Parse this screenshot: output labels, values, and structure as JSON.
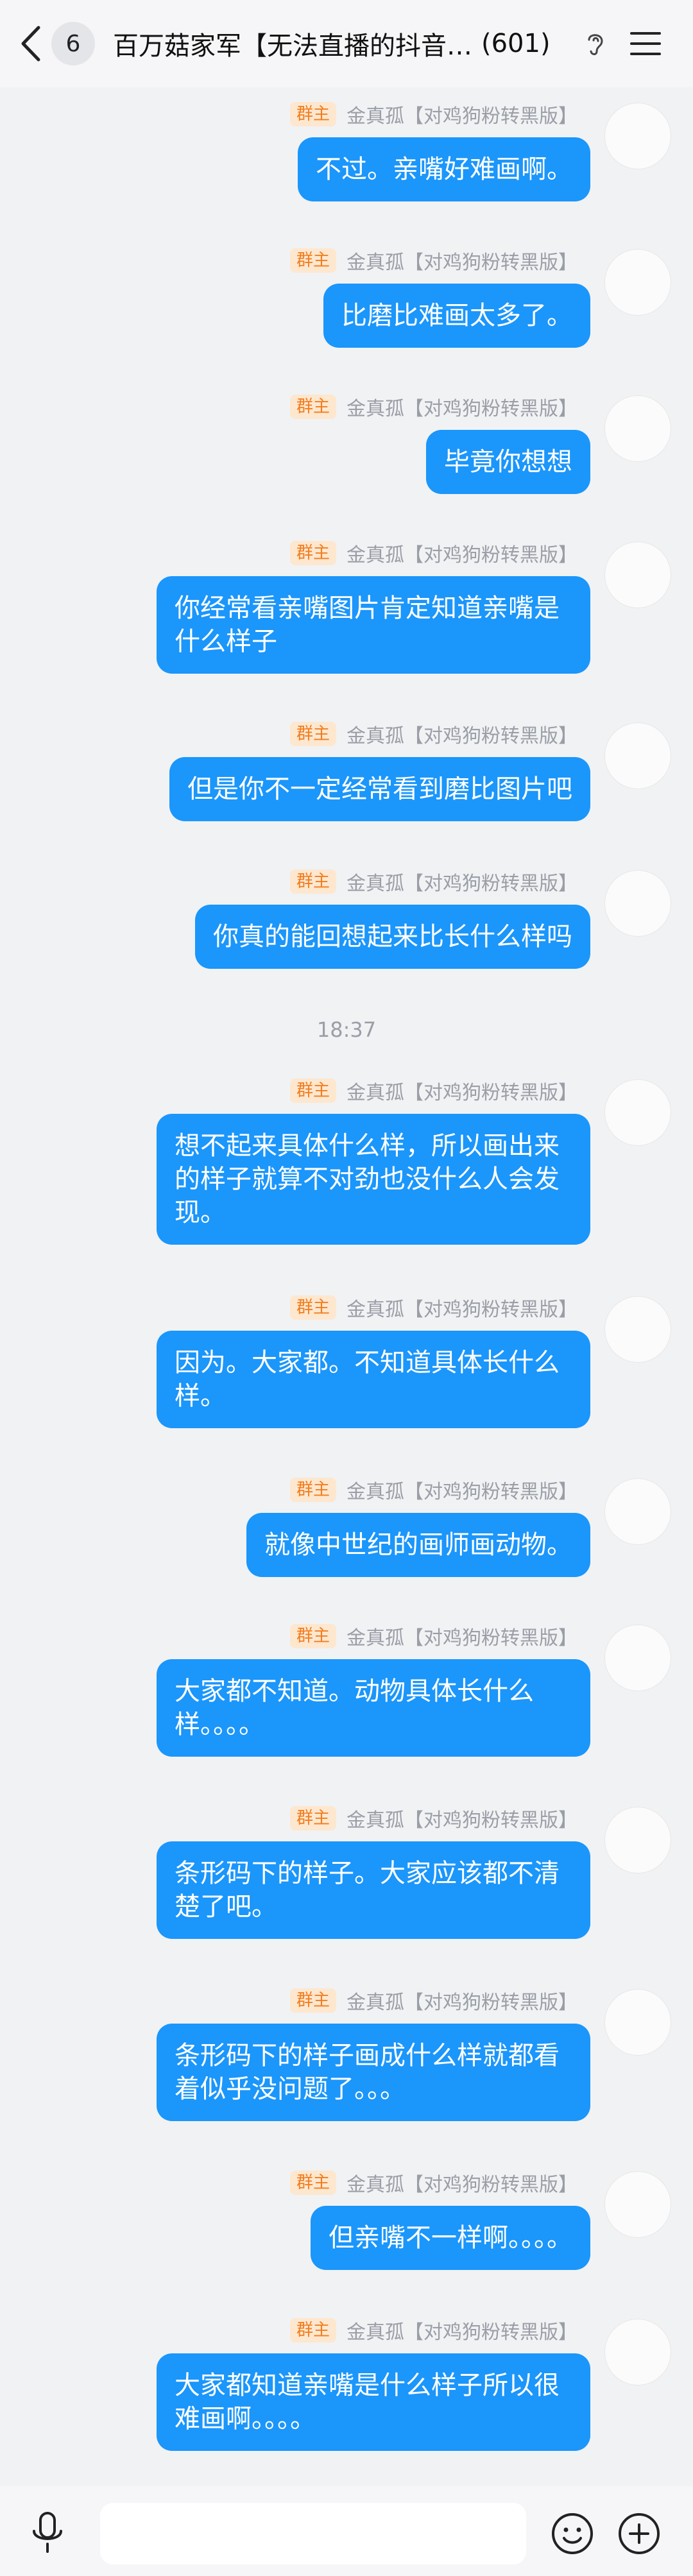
{
  "header": {
    "unread_count": "6",
    "group_name": "百万菇家军【无法直播的抖音…",
    "member_count": "(601)",
    "back_icon": "chevron-left-icon",
    "ear_icon": "ear-icon",
    "menu_icon": "hamburger-menu-icon"
  },
  "sender": {
    "role": "群主",
    "nickname": "金真孤【对鸡狗粉转黑版】"
  },
  "messages": [
    {
      "text": "不过。亲嘴好难画啊。"
    },
    {
      "text": "比磨比难画太多了。"
    },
    {
      "text": "毕竟你想想"
    },
    {
      "text": "你经常看亲嘴图片肯定知道亲嘴是什么样子"
    },
    {
      "text": "但是你不一定经常看到磨比图片吧"
    },
    {
      "text": "你真的能回想起来比长什么样吗"
    },
    {
      "text": "想不起来具体什么样，所以画出来的样子就算不对劲也没什么人会发现。"
    },
    {
      "text": "因为。大家都。不知道具体长什么样。"
    },
    {
      "text": "就像中世纪的画师画动物。"
    },
    {
      "text": "大家都不知道。动物具体长什么样。。。。"
    },
    {
      "text": "条形码下的样子。大家应该都不清楚了吧。"
    },
    {
      "text": "条形码下的样子画成什么样就都看着似乎没问题了。。。"
    },
    {
      "text": "但亲嘴不一样啊。。。。"
    },
    {
      "text": "大家都知道亲嘴是什么样子所以很难画啊。。。。"
    }
  ],
  "timestamp": "18:37",
  "bottom": {
    "mic_icon": "microphone-icon",
    "emoji_icon": "smiley-icon",
    "add_icon": "plus-circle-icon"
  },
  "colors": {
    "bubble": "#1b96fb",
    "background": "#f1f2f4",
    "role_badge_bg": "#fde7cf",
    "role_badge_text": "#f27d1f"
  }
}
